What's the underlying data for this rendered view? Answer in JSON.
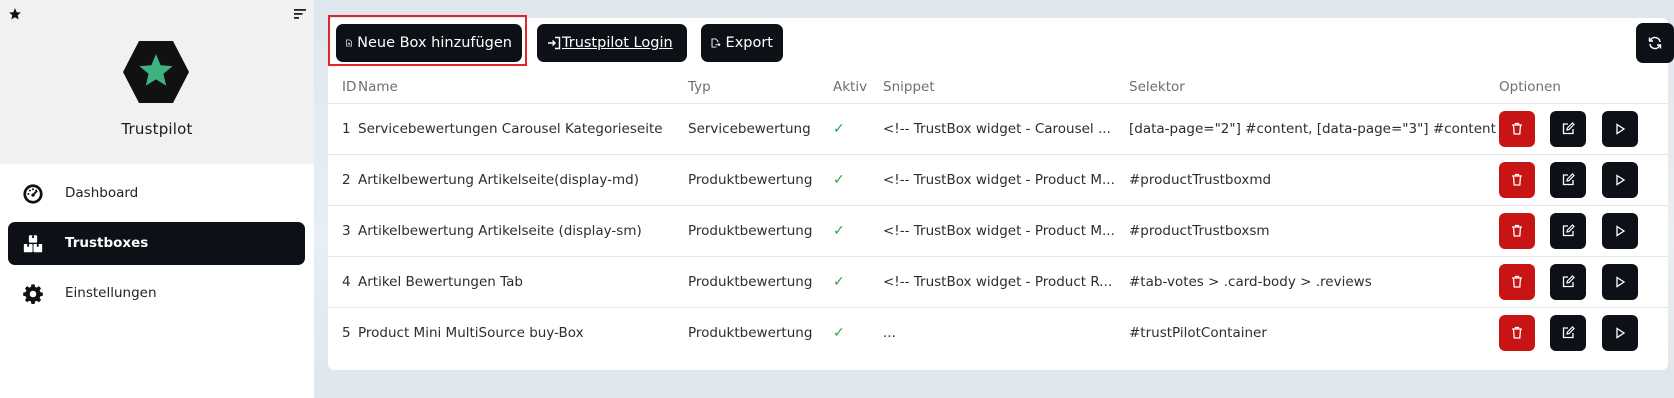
{
  "sidebar": {
    "brand": "Trustpilot",
    "items": [
      {
        "label": "Dashboard",
        "icon": "dashboard-gauge-icon",
        "active": false
      },
      {
        "label": "Trustboxes",
        "icon": "boxes-icon",
        "active": true
      },
      {
        "label": "Einstellungen",
        "icon": "gear-icon",
        "active": false
      }
    ]
  },
  "toolbar": {
    "add_label": "Neue Box hinzufügen",
    "login_label": " Trustpilot Login",
    "export_label": "Export"
  },
  "table": {
    "headers": [
      "ID",
      "Name",
      "Typ",
      "Aktiv",
      "Snippet",
      "Selektor",
      "Optionen"
    ],
    "rows": [
      {
        "id": "1",
        "name": "Servicebewertungen Carousel Kategorieseite",
        "typ": "Servicebewertung",
        "aktiv": "✓",
        "snippet": "<!-- TrustBox widget - Carousel ...",
        "selektor": "[data-page=\"2\"] #content, [data-page=\"3\"] #content"
      },
      {
        "id": "2",
        "name": "Artikelbewertung Artikelseite(display-md)",
        "typ": "Produktbewertung",
        "aktiv": "✓",
        "snippet": "<!-- TrustBox widget - Product M...",
        "selektor": "#productTrustboxmd"
      },
      {
        "id": "3",
        "name": "Artikelbewertung Artikelseite (display-sm)",
        "typ": "Produktbewertung",
        "aktiv": "✓",
        "snippet": "<!-- TrustBox widget - Product M...",
        "selektor": "#productTrustboxsm"
      },
      {
        "id": "4",
        "name": "Artikel Bewertungen Tab",
        "typ": "Produktbewertung",
        "aktiv": "✓",
        "snippet": "<!-- TrustBox widget - Product R...",
        "selektor": "#tab-votes > .card-body > .reviews"
      },
      {
        "id": "5",
        "name": "Product Mini MultiSource buy-Box",
        "typ": "Produktbewertung",
        "aktiv": "✓",
        "snippet": "...",
        "selektor": "#trustPilotContainer"
      }
    ]
  },
  "colors": {
    "primary": "#0d1117",
    "danger": "#c81414",
    "success": "#2fa24a",
    "highlight": "#e0262b",
    "logo_star": "#3fb37f"
  }
}
